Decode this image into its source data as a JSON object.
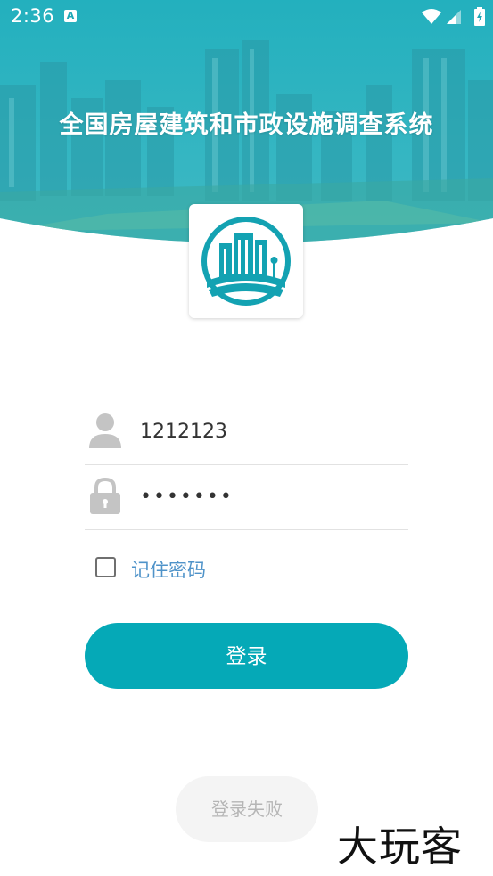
{
  "status_bar": {
    "time": "2:36",
    "notification_icon_letter": "A",
    "icons": [
      "wifi-icon",
      "signal-icon",
      "battery-icon"
    ]
  },
  "header": {
    "title": "全国房屋建筑和市政设施调查系统"
  },
  "login_form": {
    "username_value": "1212123",
    "password_value": "1234567",
    "remember_label": "记住密码",
    "remember_checked": false,
    "login_button": "登录"
  },
  "toast": {
    "message": "登录失败"
  },
  "watermark": {
    "text": "大玩客"
  },
  "colors": {
    "accent": "#05a9b7",
    "header_teal": "#1fa7b6",
    "link_blue": "#4f93c9"
  }
}
